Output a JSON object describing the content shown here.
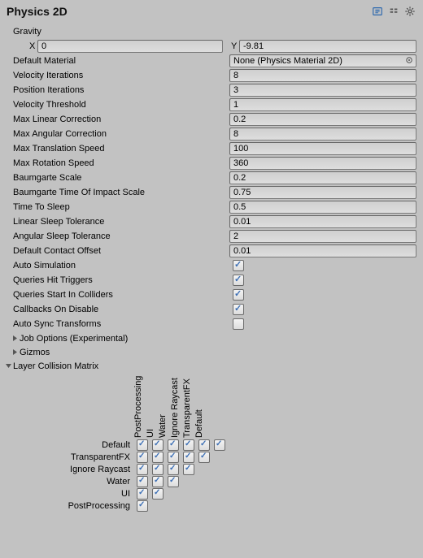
{
  "header": {
    "title": "Physics 2D"
  },
  "gravity": {
    "label": "Gravity",
    "xLabel": "X",
    "xValue": "0",
    "yLabel": "Y",
    "yValue": "-9.81"
  },
  "material": {
    "label": "Default Material",
    "value": "None (Physics Material 2D)"
  },
  "fields": [
    {
      "label": "Velocity Iterations",
      "value": "8"
    },
    {
      "label": "Position Iterations",
      "value": "3"
    },
    {
      "label": "Velocity Threshold",
      "value": "1"
    },
    {
      "label": "Max Linear Correction",
      "value": "0.2"
    },
    {
      "label": "Max Angular Correction",
      "value": "8"
    },
    {
      "label": "Max Translation Speed",
      "value": "100"
    },
    {
      "label": "Max Rotation Speed",
      "value": "360"
    },
    {
      "label": "Baumgarte Scale",
      "value": "0.2"
    },
    {
      "label": "Baumgarte Time Of Impact Scale",
      "value": "0.75"
    },
    {
      "label": "Time To Sleep",
      "value": "0.5"
    },
    {
      "label": "Linear Sleep Tolerance",
      "value": "0.01"
    },
    {
      "label": "Angular Sleep Tolerance",
      "value": "2"
    },
    {
      "label": "Default Contact Offset",
      "value": "0.01"
    }
  ],
  "toggles": [
    {
      "label": "Auto Simulation",
      "checked": true
    },
    {
      "label": "Queries Hit Triggers",
      "checked": true
    },
    {
      "label": "Queries Start In Colliders",
      "checked": true
    },
    {
      "label": "Callbacks On Disable",
      "checked": true
    },
    {
      "label": "Auto Sync Transforms",
      "checked": false
    }
  ],
  "foldouts": {
    "jobOptions": {
      "label": "Job Options (Experimental)",
      "expanded": false
    },
    "gizmos": {
      "label": "Gizmos",
      "expanded": false
    },
    "matrix": {
      "label": "Layer Collision Matrix",
      "expanded": true
    }
  },
  "matrix": {
    "layers": [
      "Default",
      "TransparentFX",
      "Ignore Raycast",
      "Water",
      "UI",
      "PostProcessing"
    ]
  }
}
